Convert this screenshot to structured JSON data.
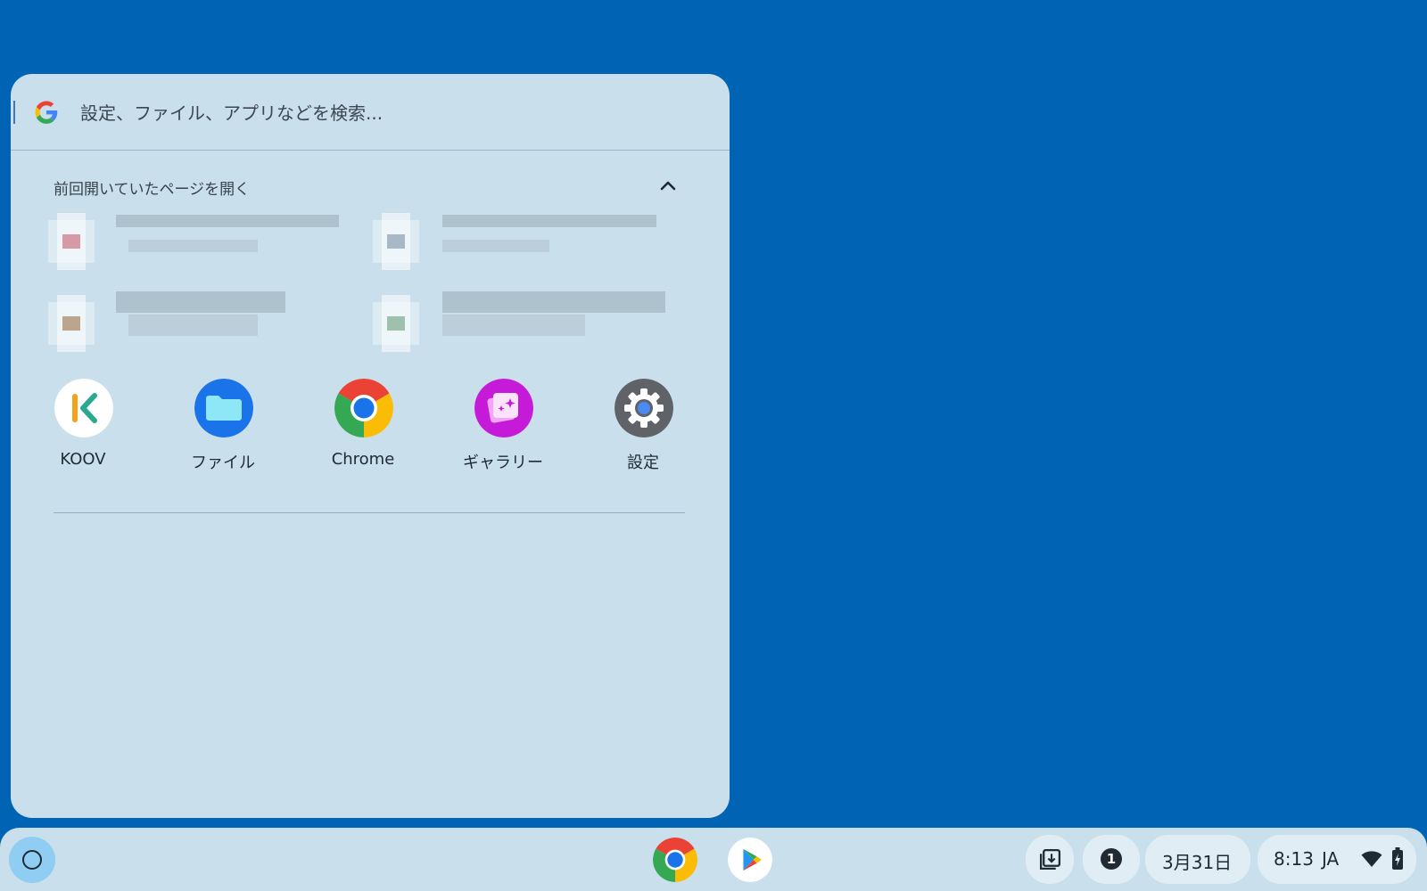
{
  "search": {
    "placeholder": "設定、ファイル、アプリなどを検索..."
  },
  "recent": {
    "title": "前回開いていたページを開く"
  },
  "apps": [
    {
      "label": "KOOV",
      "icon": "koov-icon"
    },
    {
      "label": "ファイル",
      "icon": "files-folder-icon"
    },
    {
      "label": "Chrome",
      "icon": "chrome-icon"
    },
    {
      "label": "ギャラリー",
      "icon": "gallery-icon"
    },
    {
      "label": "設定",
      "icon": "settings-gear-icon"
    }
  ],
  "shelf": {
    "pinned": [
      "chrome-icon",
      "play-store-icon"
    ],
    "notification_count": "1",
    "date": "3月31日",
    "time": "8:13",
    "ime": "JA"
  },
  "colors": {
    "wallpaper": "#0063b4",
    "panel": "#c9dfeb",
    "launcher_button": "#8fcdf2"
  }
}
